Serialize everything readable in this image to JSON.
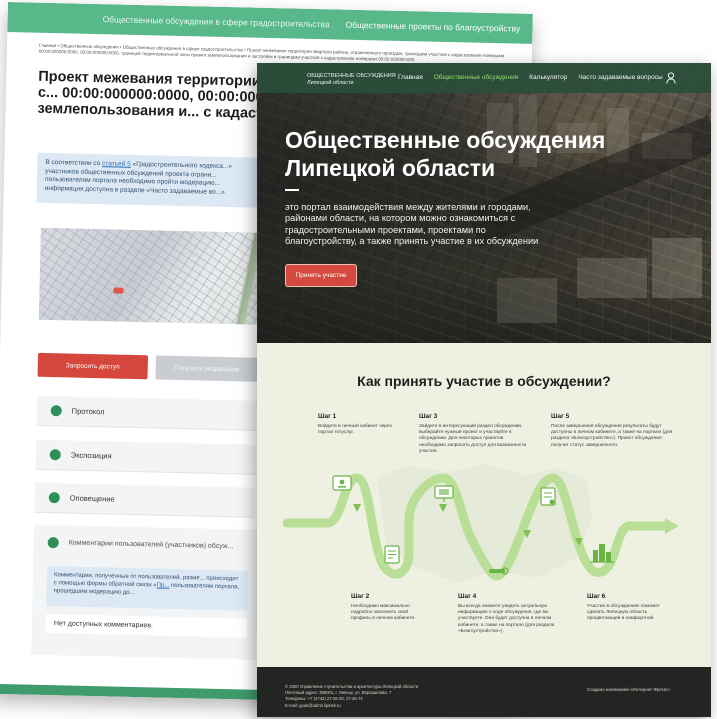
{
  "back_page": {
    "nav": {
      "left_label": "Общественные обсуждения в сфере градостроительства",
      "right_label": "Общественные проекты по благоустройству"
    },
    "breadcrumbs": "Главная  •  Общественные обсуждения  •  Общественные обсуждения в сфере градостроительства  •  Проект межевания территории квартала района, ограниченного проездом, границами участков с кадастровыми номерами 00:00:000000:0000, 00:00:000000:0000, границей территориальной зоны правил землепользования и застройки и границами участков с кадастровыми номерами 00:00:000000:000",
    "title": "Проект межевания территории к... проездом, границами участков с... 00:00:000000:0000, 00:00:000000... зоны правил землепользования и... с кадастровыми номерами 00:00:...",
    "info_prefix": "В соответствии со ",
    "info_link": "статьей 5",
    "info_rest": " «Градостроительного кодекса...» участников общественных обсуждений проекта ограни... пользователям портала необходимо пройти модерацию... информация доступна в разделе «Часто задаваемые во...»",
    "request_access_button": "Запросить доступ",
    "moderation_button": "Получить модерацию",
    "accordion": [
      "Протокол",
      "Экспозиция",
      "Оповещение"
    ],
    "comments_title": "Комментарии пользователей (участников) обсуж...",
    "comments_note": "Комментарии, полученные от пользователей, разме... происходит с помощью формы обратной связи «",
    "comments_note_link": "Пр...",
    "comments_note_rest": "пользователям портала, прошедшим модерацию до...",
    "no_comments": "Нет доступных комментариев."
  },
  "front_page": {
    "logo_line1": "ОБЩЕСТВЕННЫЕ ОБСУЖДЕНИЯ",
    "logo_line2": "Липецкой области",
    "menu": [
      {
        "label": "Главная",
        "active": false
      },
      {
        "label": "Общественные обсуждения",
        "active": true
      },
      {
        "label": "Калькулятор",
        "active": false
      },
      {
        "label": "Часто задаваемые вопросы",
        "active": false
      }
    ],
    "hero_title": "Общественные обсуждения Липецкой области",
    "hero_text": "это портал взаимодействия между жителями и городами, районами области, на котором можно ознакомиться с градостроительными проектами, проектами по благоустройству, а также принять участие в их обсуждении",
    "hero_button": "Принять участие",
    "how_title": "Как принять участие в обсуждении?",
    "steps": [
      {
        "title": "Шаг 1",
        "text": "Войдите в личный кабинет через портал госуслуг."
      },
      {
        "title": "Шаг 2",
        "text": "Необходимо максимально подробно заполнить свой профиль в личном кабинете."
      },
      {
        "title": "Шаг 3",
        "text": "Зайдите в интересующий раздел обсуждений, выберайте нужный проект и участвуйте в обсуждении. Для некоторых проектов необходимо запросить доступ для возможности участия."
      },
      {
        "title": "Шаг 4",
        "text": "Вы всегда сможете увидеть актуальную информацию о ходе обсуждения, где вы участвуете. Она будет доступна в личном кабинете, а также на портале (для раздела «Благоустройство»)."
      },
      {
        "title": "Шаг 5",
        "text": "После завершения обсуждения результаты будут доступны в личном кабинете, а также на портале (для раздела «Благоустройство»). Проект обсуждения получит статус завершенного."
      },
      {
        "title": "Шаг 6",
        "text": "Участие в обсуждениях поможет сделать Липецкую область процветающей и комфортной."
      }
    ],
    "footer": {
      "copyright": "© 2020 Управление строительства и архитектуры Липецкой области",
      "address": "Почтовый адрес: 398001, г. Липецк, ул. Ворошилова, 7",
      "phone": "Телефоны: +7 (4742) 27-26-20, 27-45-74",
      "email": "E-mail: guas@admlr.lipetsk.ru",
      "credit": "Создано компанией «Интернет-Фрегат»"
    },
    "colors": {
      "accent_green": "#8fd16a",
      "track_green": "#b9df97",
      "red_button": "#d44a3e",
      "dark_footer": "#222521"
    }
  }
}
